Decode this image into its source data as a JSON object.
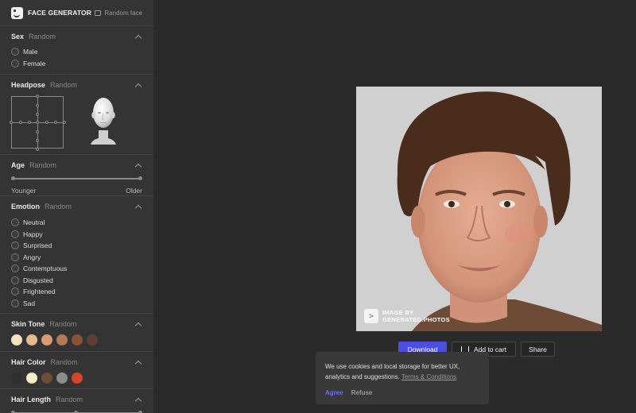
{
  "app": {
    "brand": "FACE GENERATOR",
    "random_face": "Random face"
  },
  "sections": {
    "sex": {
      "title": "Sex",
      "random": "Random",
      "options": [
        "Male",
        "Female"
      ]
    },
    "headpose": {
      "title": "Headpose",
      "random": "Random"
    },
    "age": {
      "title": "Age",
      "random": "Random",
      "min_label": "Younger",
      "max_label": "Older"
    },
    "emotion": {
      "title": "Emotion",
      "random": "Random",
      "options": [
        "Neutral",
        "Happy",
        "Surprised",
        "Angry",
        "Contemptuous",
        "Disgusted",
        "Frightened",
        "Sad"
      ]
    },
    "skin_tone": {
      "title": "Skin Tone",
      "random": "Random",
      "colors": [
        "#f3e2c0",
        "#e7b98f",
        "#dc9a72",
        "#b27a55",
        "#8a5433",
        "#5b3f33"
      ]
    },
    "hair_color": {
      "title": "Hair Color",
      "random": "Random",
      "colors": [
        "#2f2f2f",
        "#f6efc6",
        "#6f4c37",
        "#8c8c8c",
        "#d8432a"
      ]
    },
    "hair_length": {
      "title": "Hair Length",
      "random": "Random"
    }
  },
  "photo": {
    "watermark_line1": "IMAGE BY",
    "watermark_line2": "GENERATED.PHOTOS",
    "watermark_icon": ">"
  },
  "actions": {
    "download": "Download",
    "add_to_cart": "Add to cart",
    "share": "Share"
  },
  "cookie": {
    "text": "We use cookies and local storage for better UX, analytics and suggestions.",
    "link": "Terms & Conditions",
    "agree": "Agree",
    "refuse": "Refuse"
  },
  "colors": {
    "accent": "#4a4fe0",
    "agree": "#6b70f0"
  }
}
